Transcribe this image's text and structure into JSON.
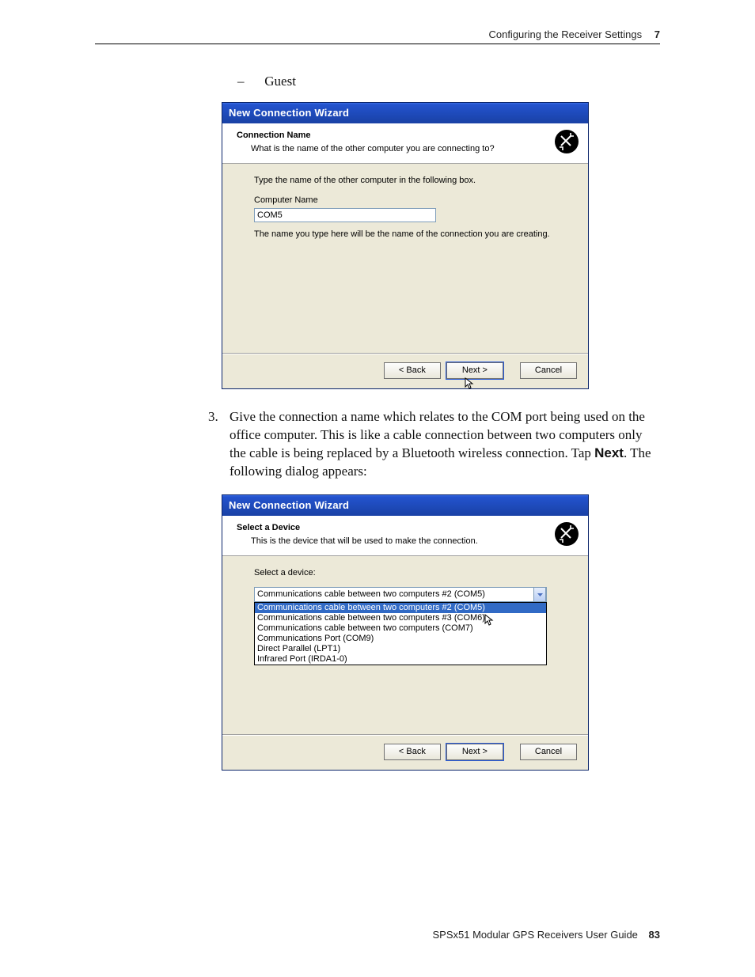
{
  "header": {
    "section_title": "Configuring the Receiver Settings",
    "chapter_number": "7"
  },
  "bullet": {
    "dash": "–",
    "text": "Guest"
  },
  "dialog1": {
    "window_title": "New Connection Wizard",
    "header_title": "Connection Name",
    "header_sub": "What is the name of the other computer you are connecting to?",
    "body_intro": "Type the name of the other computer in the following box.",
    "input_label": "Computer Name",
    "input_value": "COM5",
    "body_note": "The name you type here will be the name of the connection you are creating.",
    "buttons": {
      "back": "< Back",
      "next": "Next >",
      "cancel": "Cancel"
    }
  },
  "step3": {
    "number": "3.",
    "text_a": "Give the connection a name which relates to the COM port being used on the office computer. This is like a cable connection between two computers only the cable is being replaced by a Bluetooth wireless connection. Tap ",
    "bold": "Next",
    "text_b": ". The following dialog appears:"
  },
  "dialog2": {
    "window_title": "New Connection Wizard",
    "header_title": "Select a Device",
    "header_sub": "This is the device that will be used to make the connection.",
    "body_intro": "Select a device:",
    "selected": "Communications cable between two computers #2 (COM5)",
    "options": [
      "Communications cable between two computers #2 (COM5)",
      "Communications cable between two computers #3 (COM6)",
      "Communications cable between two computers (COM7)",
      "Communications Port (COM9)",
      "Direct Parallel (LPT1)",
      "Infrared Port (IRDA1-0)"
    ],
    "buttons": {
      "back": "< Back",
      "next": "Next >",
      "cancel": "Cancel"
    }
  },
  "footer": {
    "guide_title": "SPSx51 Modular GPS Receivers User Guide",
    "page_number": "83"
  }
}
